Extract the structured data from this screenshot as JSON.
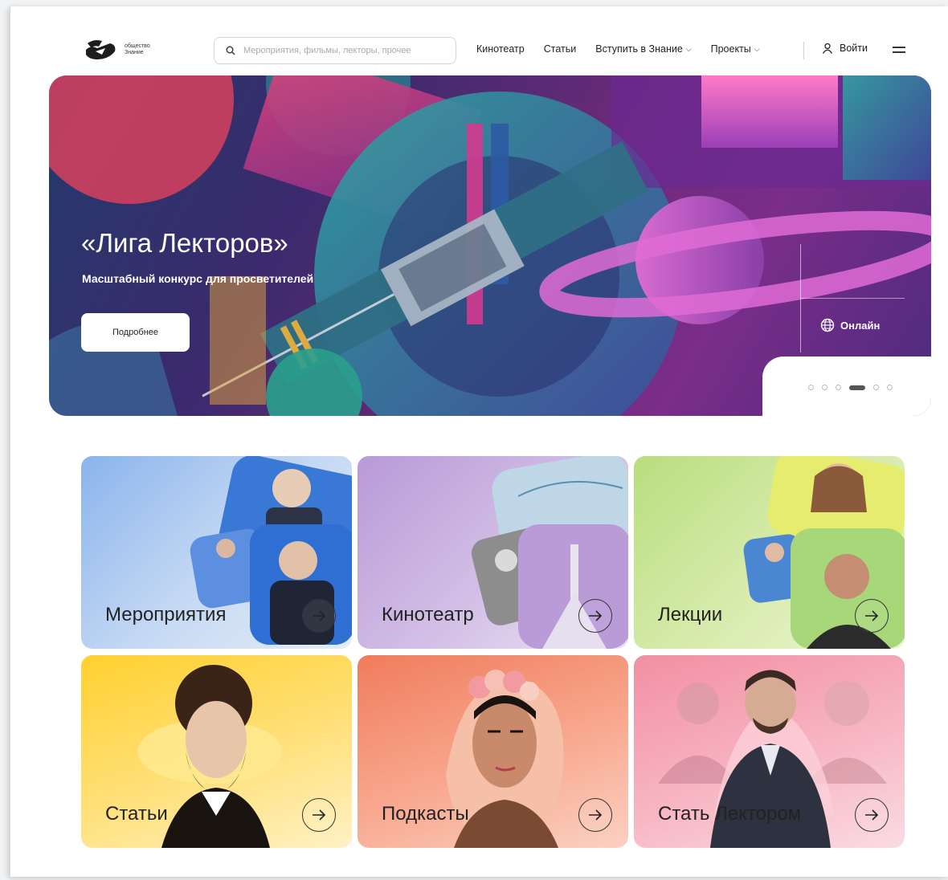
{
  "header": {
    "logo_text_line1": "общество",
    "logo_text_line2": "Знание",
    "search_placeholder": "Мероприятия, фильмы, лекторы, прочее",
    "nav": [
      {
        "label": "Кинотеатр",
        "dropdown": false
      },
      {
        "label": "Статьи",
        "dropdown": false
      },
      {
        "label": "Вступить в Знание",
        "dropdown": true
      },
      {
        "label": "Проекты",
        "dropdown": true
      }
    ],
    "login_label": "Войти"
  },
  "hero": {
    "title": "«Лига Лекторов»",
    "subtitle": "Масштабный конкурс для просветителей",
    "button_label": "Подробнее",
    "format_label": "Онлайн",
    "slides_total": 6,
    "active_slide": 4
  },
  "cards": [
    {
      "label": "Мероприятия"
    },
    {
      "label": "Кинотеатр"
    },
    {
      "label": "Лекции"
    },
    {
      "label": "Статьи"
    },
    {
      "label": "Подкасты"
    },
    {
      "label": "Стать Лектором"
    }
  ],
  "icons": {
    "search": "search-icon",
    "user": "user-icon",
    "menu": "burger-menu-icon",
    "globe": "globe-icon",
    "arrow": "arrow-right-icon"
  },
  "colors": {
    "hero_bg": "#4a2a78",
    "card_events": "#8ab4ec",
    "card_cinema": "#b89ad7",
    "card_lectures": "#b9dd7e",
    "card_articles": "#ffd02e",
    "card_podcasts": "#f07c5c",
    "card_become": "#f28fa3"
  }
}
